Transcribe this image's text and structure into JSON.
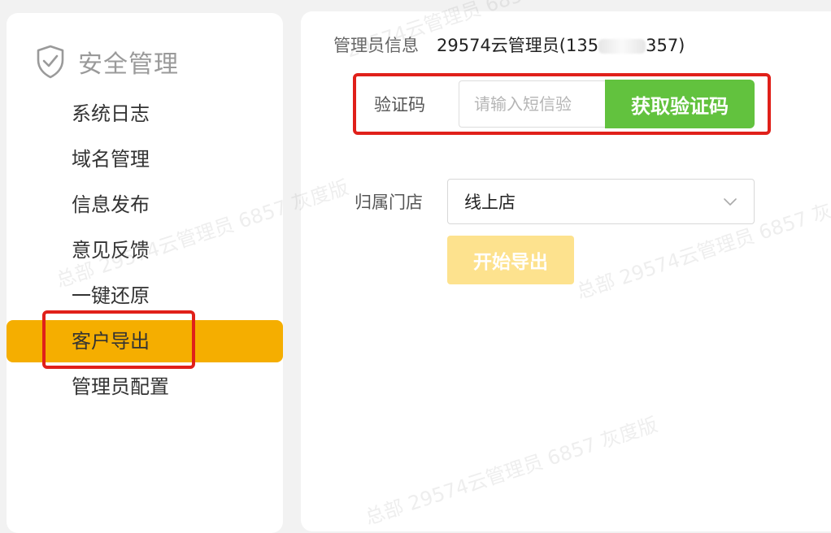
{
  "sidebar": {
    "title": "安全管理",
    "icon": "shield-check-icon",
    "items": [
      {
        "label": "系统日志"
      },
      {
        "label": "域名管理"
      },
      {
        "label": "信息发布"
      },
      {
        "label": "意见反馈"
      },
      {
        "label": "一键还原"
      },
      {
        "label": "客户导出",
        "active": true
      },
      {
        "label": "管理员配置"
      }
    ]
  },
  "main": {
    "admin_info_label": "管理员信息",
    "admin_name": "29574云管理员(135",
    "admin_phone_tail": "357)",
    "verify_label": "验证码",
    "verify_placeholder": "请输入短信验",
    "get_code_button": "获取验证码",
    "store_label": "归属门店",
    "store_selected": "线上店",
    "export_button": "开始导出"
  },
  "watermark": {
    "text_a": "总部 29574云管理员 6857 灰度版",
    "text_b": "29574云管理员 6857"
  },
  "colors": {
    "accent": "#f5ae00",
    "get_code": "#62c23e",
    "export_disabled": "#fde28e",
    "highlight": "#e0201a"
  }
}
